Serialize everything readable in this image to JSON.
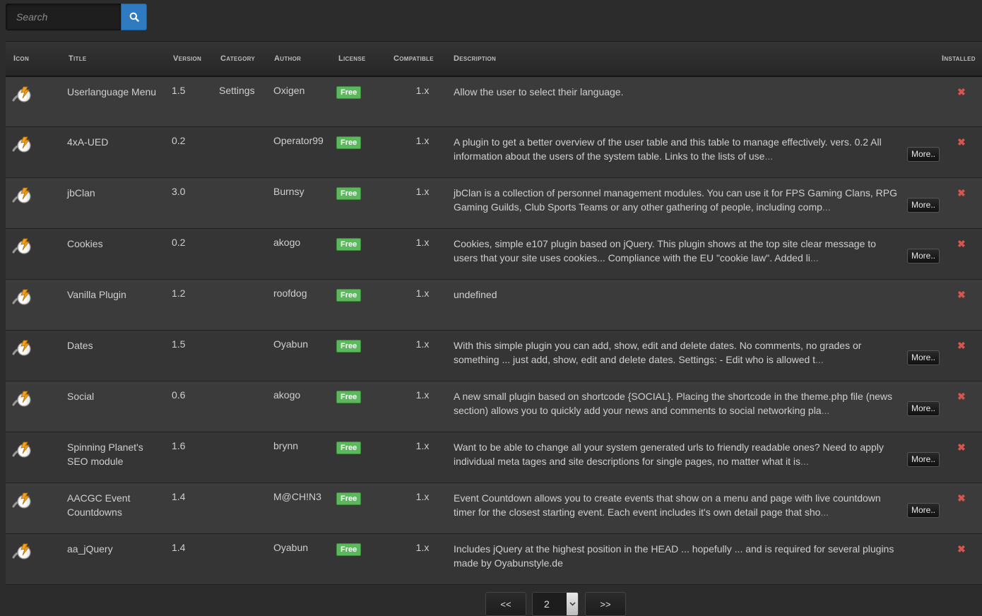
{
  "search": {
    "placeholder": "Search"
  },
  "table": {
    "headers": {
      "icon": "Icon",
      "title": "Title",
      "version": "Version",
      "category": "Category",
      "author": "Author",
      "license": "License",
      "compatible": "Compatible",
      "description": "Description",
      "installed": "Installed"
    },
    "rows": [
      {
        "title": "Userlanguage Menu",
        "version": "1.5",
        "category": "Settings",
        "author": "Oxigen",
        "license": "Free",
        "compatible": "1.x",
        "description": "Allow the user to select their language.",
        "ellipsis": "",
        "more": ""
      },
      {
        "title": "4xA-UED",
        "version": "0.2",
        "category": "",
        "author": "Operator99",
        "license": "Free",
        "compatible": "1.x",
        "description": "A plugin to get a better overview of the user table and this table to manage effectively. vers. 0.2 All information about the users of the system table. Links to the lists of use",
        "ellipsis": "...",
        "more": "More.."
      },
      {
        "title": "jbClan",
        "version": "3.0",
        "category": "",
        "author": "Burnsy",
        "license": "Free",
        "compatible": "1.x",
        "description": "jbClan is a collection of personnel management modules. You can use it for FPS Gaming Clans, RPG Gaming Guilds, Club Sports Teams or any other gathering of people, including comp",
        "ellipsis": "...",
        "more": "More.."
      },
      {
        "title": "Cookies",
        "version": "0.2",
        "category": "",
        "author": "akogo",
        "license": "Free",
        "compatible": "1.x",
        "description": "Cookies, simple e107 plugin based on jQuery. This plugin shows at the top site clear message to users that your site uses cookies... Compliance with the EU \"cookie law\". Added li",
        "ellipsis": "...",
        "more": "More.."
      },
      {
        "title": "Vanilla Plugin",
        "version": "1.2",
        "category": "",
        "author": "roofdog",
        "license": "Free",
        "compatible": "1.x",
        "description": "undefined",
        "ellipsis": "",
        "more": ""
      },
      {
        "title": "Dates",
        "version": "1.5",
        "category": "",
        "author": "Oyabun",
        "license": "Free",
        "compatible": "1.x",
        "description": "With this simple plugin you can add, show, edit and delete dates. No comments, no grades or something ... just add, show, edit and delete dates. Settings: - Edit who is allowed t",
        "ellipsis": "...",
        "more": "More.."
      },
      {
        "title": "Social",
        "version": "0.6",
        "category": "",
        "author": "akogo",
        "license": "Free",
        "compatible": "1.x",
        "description": "A new small plugin based on shortcode {SOCIAL}. Placing the shortcode in the theme.php file (news section) allows you to quickly add your news and comments to social networking pla",
        "ellipsis": "...",
        "more": "More.."
      },
      {
        "title": "Spinning Planet's SEO module",
        "version": "1.6",
        "category": "",
        "author": "brynn",
        "license": "Free",
        "compatible": "1.x",
        "description": "Want to be able to change all your system generated urls to friendly readable ones? Need to apply individual meta tages and site descriptions for single pages, no matter what it is",
        "ellipsis": "...",
        "more": "More.."
      },
      {
        "title": "AACGC Event Countdowns",
        "version": "1.4",
        "category": "",
        "author": "M@CH!N3",
        "license": "Free",
        "compatible": "1.x",
        "description": "Event Countdown allows you to create events that show on a menu and page with live countdown timer for the closest starting event. Each event includes it's own detail page that sho",
        "ellipsis": "...",
        "more": "More.."
      },
      {
        "title": "aa_jQuery",
        "version": "1.4",
        "category": "",
        "author": "Oyabun",
        "license": "Free",
        "compatible": "1.x",
        "description": "Includes jQuery at the highest position in the HEAD ... hopefully ... and is required for several plugins made by Oyabunstyle.de",
        "ellipsis": "",
        "more": ""
      }
    ],
    "remove_symbol": "✖"
  },
  "pagination": {
    "prev": "<<",
    "next": ">>",
    "current_page": "2"
  },
  "colors": {
    "accent": "#2f7bc1",
    "free_badge": "#5cb85c",
    "remove": "#d9534f"
  }
}
